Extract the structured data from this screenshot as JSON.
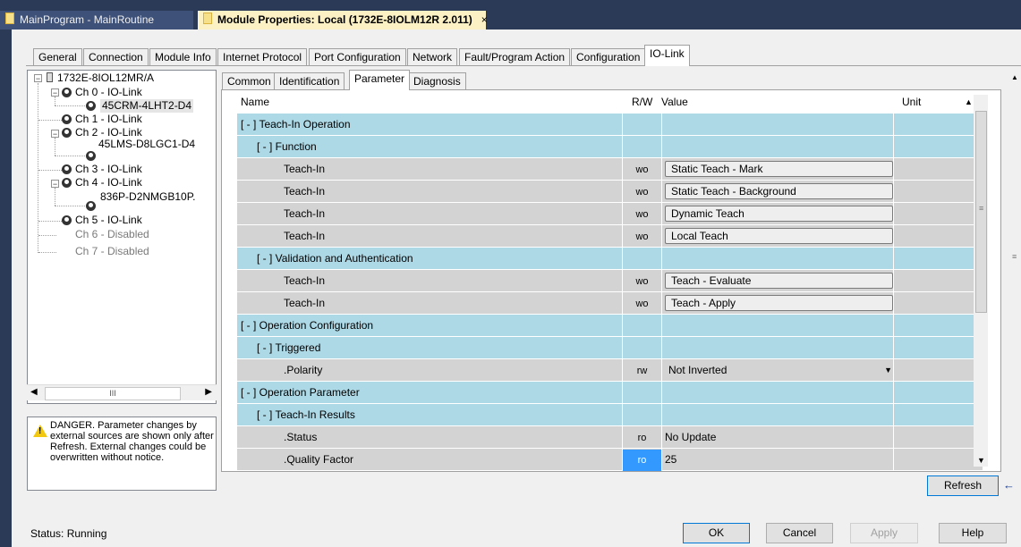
{
  "doc_tabs": [
    {
      "label": "MainProgram - MainRoutine"
    },
    {
      "label": "Module Properties: Local (1732E-8IOLM12R 2.011)",
      "close": "×"
    }
  ],
  "tabs": [
    "General",
    "Connection",
    "Module Info",
    "Internet Protocol",
    "Port Configuration",
    "Network",
    "Fault/Program Action",
    "Configuration",
    "IO-Link"
  ],
  "active_tab": "IO-Link",
  "tree": {
    "root": "1732E-8IOL12MR/A",
    "ch0": "Ch 0 - IO-Link",
    "ch0_dev": "45CRM-4LHT2-D4",
    "ch1": "Ch 1 - IO-Link",
    "ch2": "Ch 2 - IO-Link",
    "ch2_dev": "45LMS-D8LGC1-D4",
    "ch3": "Ch 3 - IO-Link",
    "ch4": "Ch 4 - IO-Link",
    "ch4_dev": "836P-D2NMGB10P.",
    "ch5": "Ch 5 - IO-Link",
    "ch6": "Ch 6 - Disabled",
    "ch7": "Ch 7 - Disabled",
    "scroll_mid": "III"
  },
  "danger_text": "DANGER. Parameter changes by external sources are shown only after Refresh. External changes could be overwritten without notice.",
  "sub_tabs": [
    "Common",
    "Identification",
    "Parameter",
    "Diagnosis"
  ],
  "active_sub_tab": "Parameter",
  "grid": {
    "headers": {
      "name": "Name",
      "rw": "R/W",
      "value": "Value",
      "unit": "Unit"
    },
    "rows": [
      {
        "type": "group",
        "level": 0,
        "name": "[ - ]  Teach-In Operation"
      },
      {
        "type": "group",
        "level": 1,
        "name": "[ - ]  Function"
      },
      {
        "type": "item",
        "level": 2,
        "name": "Teach-In",
        "rw": "wo",
        "value": "Static Teach - Mark",
        "control": "button"
      },
      {
        "type": "item",
        "level": 2,
        "name": "Teach-In",
        "rw": "wo",
        "value": "Static Teach - Background",
        "control": "button"
      },
      {
        "type": "item",
        "level": 2,
        "name": "Teach-In",
        "rw": "wo",
        "value": "Dynamic Teach",
        "control": "button"
      },
      {
        "type": "item",
        "level": 2,
        "name": "Teach-In",
        "rw": "wo",
        "value": "Local Teach",
        "control": "button"
      },
      {
        "type": "group",
        "level": 1,
        "name": "[ - ]  Validation and Authentication"
      },
      {
        "type": "item",
        "level": 2,
        "name": "Teach-In",
        "rw": "wo",
        "value": "Teach - Evaluate",
        "control": "button"
      },
      {
        "type": "item",
        "level": 2,
        "name": "Teach-In",
        "rw": "wo",
        "value": "Teach - Apply",
        "control": "button"
      },
      {
        "type": "group",
        "level": 0,
        "name": "[ - ]  Operation Configuration"
      },
      {
        "type": "group",
        "level": 1,
        "name": "[ - ]  Triggered"
      },
      {
        "type": "item",
        "level": 2,
        "name": ".Polarity",
        "rw": "rw",
        "value": "Not Inverted",
        "control": "select"
      },
      {
        "type": "group",
        "level": 0,
        "name": "[ - ]  Operation Parameter"
      },
      {
        "type": "group",
        "level": 1,
        "name": "[ - ]  Teach-In Results"
      },
      {
        "type": "item",
        "level": 2,
        "name": ".Status",
        "rw": "ro",
        "value": "No Update",
        "control": "text"
      },
      {
        "type": "item",
        "level": 2,
        "name": ".Quality Factor",
        "rw": "ro",
        "value": "25",
        "control": "text",
        "selected_rw": true
      }
    ]
  },
  "buttons": {
    "refresh": "Refresh",
    "ok": "OK",
    "cancel": "Cancel",
    "apply": "Apply",
    "help": "Help"
  },
  "status": "Status:  Running",
  "colors": {
    "group_row": "#add8e6",
    "item_row": "#d3d3d3",
    "selection": "#3399ff",
    "tab_bar": "#2b3b57",
    "active_doc_tab": "#fbf1c4"
  }
}
